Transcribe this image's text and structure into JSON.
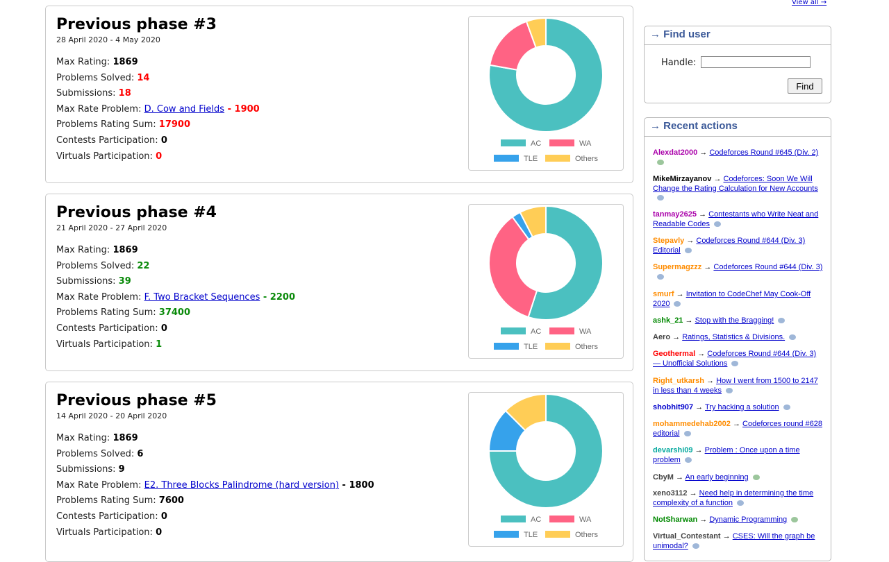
{
  "phases": [
    {
      "title": "Previous phase #3",
      "dates": "28 April 2020 - 4 May 2020",
      "max_rating_label": "Max Rating: ",
      "max_rating": "1869",
      "solved_label": "Problems Solved: ",
      "solved": "14",
      "submissions_label": "Submissions: ",
      "submissions": "18",
      "max_rate_problem_label": "Max Rate Problem: ",
      "max_rate_problem": "D. Cow and Fields",
      "max_rate_problem_value": " - 1900",
      "rating_sum_label": "Problems Rating Sum: ",
      "rating_sum": "17900",
      "contests_label": "Contests Participation: ",
      "contests": "0",
      "virtuals_label": "Virtuals Participation: ",
      "virtuals": "0",
      "color": "#f00"
    },
    {
      "title": "Previous phase #4",
      "dates": "21 April 2020 - 27 April 2020",
      "max_rating_label": "Max Rating: ",
      "max_rating": "1869",
      "solved_label": "Problems Solved: ",
      "solved": "22",
      "submissions_label": "Submissions: ",
      "submissions": "39",
      "max_rate_problem_label": "Max Rate Problem: ",
      "max_rate_problem": "F. Two Bracket Sequences",
      "max_rate_problem_value": " - 2200",
      "rating_sum_label": "Problems Rating Sum: ",
      "rating_sum": "37400",
      "contests_label": "Contests Participation: ",
      "contests": "0",
      "virtuals_label": "Virtuals Participation: ",
      "virtuals": "1",
      "color": "#0a8a0a"
    },
    {
      "title": "Previous phase #5",
      "dates": "14 April 2020 - 20 April 2020",
      "max_rating_label": "Max Rating: ",
      "max_rating": "1869",
      "solved_label": "Problems Solved: ",
      "solved": "6",
      "submissions_label": "Submissions: ",
      "submissions": "9",
      "max_rate_problem_label": "Max Rate Problem: ",
      "max_rate_problem": "E2. Three Blocks Palindrome (hard version)",
      "max_rate_problem_value": " - 1800",
      "rating_sum_label": "Problems Rating Sum: ",
      "rating_sum": "7600",
      "contests_label": "Contests Participation: ",
      "contests": "0",
      "virtuals_label": "Virtuals Participation: ",
      "virtuals": "0",
      "color": "#000"
    }
  ],
  "chart_data": [
    {
      "type": "pie",
      "donut": true,
      "categories": [
        "AC",
        "WA",
        "TLE",
        "Others"
      ],
      "values": [
        14,
        3,
        0,
        1
      ],
      "colors": [
        "#4bc0c0",
        "#ff6384",
        "#36a2eb",
        "#ffcd56"
      ],
      "legend": "bottom"
    },
    {
      "type": "pie",
      "donut": true,
      "categories": [
        "AC",
        "WA",
        "TLE",
        "Others"
      ],
      "values": [
        22,
        14,
        1,
        3
      ],
      "colors": [
        "#4bc0c0",
        "#ff6384",
        "#36a2eb",
        "#ffcd56"
      ],
      "legend": "bottom"
    },
    {
      "type": "pie",
      "donut": true,
      "categories": [
        "AC",
        "WA",
        "TLE",
        "Others"
      ],
      "values": [
        6,
        0,
        1,
        1
      ],
      "colors": [
        "#4bc0c0",
        "#ff6384",
        "#36a2eb",
        "#ffcd56"
      ],
      "legend": "bottom"
    }
  ],
  "sidebar": {
    "view_all": "View all →",
    "find_user": {
      "title": "→ Find user",
      "handle_label": "Handle:",
      "handle_value": "",
      "button": "Find"
    },
    "recent": {
      "title": "→ Recent actions",
      "items": [
        {
          "user": "Alexdat2000",
          "user_color": "#a0a",
          "link": "Codeforces Round #645 (Div. 2)",
          "bubble": "g"
        },
        {
          "user": "MikeMirzayanov",
          "user_color": "#000",
          "link": "Codeforces: Soon We Will Change the Rating Calculation for New Accounts",
          "bubble": "b"
        },
        {
          "user": "tanmay2625",
          "user_color": "#a0a",
          "link": "Contestants who Write Neat and Readable Codes",
          "bubble": "b"
        },
        {
          "user": "Stepavly",
          "user_color": "#ff8c00",
          "link": "Codeforces Round #644 (Div. 3) Editorial",
          "bubble": "b"
        },
        {
          "user": "Supermagzzz",
          "user_color": "#ff8c00",
          "link": "Codeforces Round #644 (Div. 3)",
          "bubble": "b"
        },
        {
          "user": "smurf",
          "user_color": "#ff8c00",
          "link": "Invitation to CodeChef May Cook-Off 2020",
          "bubble": "b"
        },
        {
          "user": "ashk_21",
          "user_color": "#080",
          "link": "Stop with the Bragging!",
          "bubble": "b"
        },
        {
          "user": "Aero",
          "user_color": "#444",
          "link": "Ratings, Statistics & Divisions.",
          "bubble": "b"
        },
        {
          "user": "Geothermal",
          "user_color": "#f00",
          "link": "Codeforces Round #644 (Div. 3) — Unofficial Solutions",
          "bubble": "b"
        },
        {
          "user": "Right_utkarsh",
          "user_color": "#ff8c00",
          "link": "How I went from 1500 to 2147 in less than 4 weeks",
          "bubble": "b"
        },
        {
          "user": "shobhit907",
          "user_color": "#00c",
          "link": "Try hacking a solution",
          "bubble": "b"
        },
        {
          "user": "mohammedehab2002",
          "user_color": "#ff8c00",
          "link": "Codeforces round #628 editorial",
          "bubble": "b"
        },
        {
          "user": "devarshi09",
          "user_color": "#03a89e",
          "link": "Problem : Once upon a time problem",
          "bubble": "b"
        },
        {
          "user": "CbyM",
          "user_color": "#444",
          "link": "An early beginning",
          "bubble": "g"
        },
        {
          "user": "xeno3112",
          "user_color": "#444",
          "link": "Need help in determining the time complexity of a function",
          "bubble": "b"
        },
        {
          "user": "NotSharwan",
          "user_color": "#080",
          "link": "Dynamic Programming",
          "bubble": "g"
        },
        {
          "user": "Virtual_Contestant",
          "user_color": "#444",
          "link": "CSES: Will the graph be unimodal?",
          "bubble": "b"
        }
      ]
    }
  }
}
